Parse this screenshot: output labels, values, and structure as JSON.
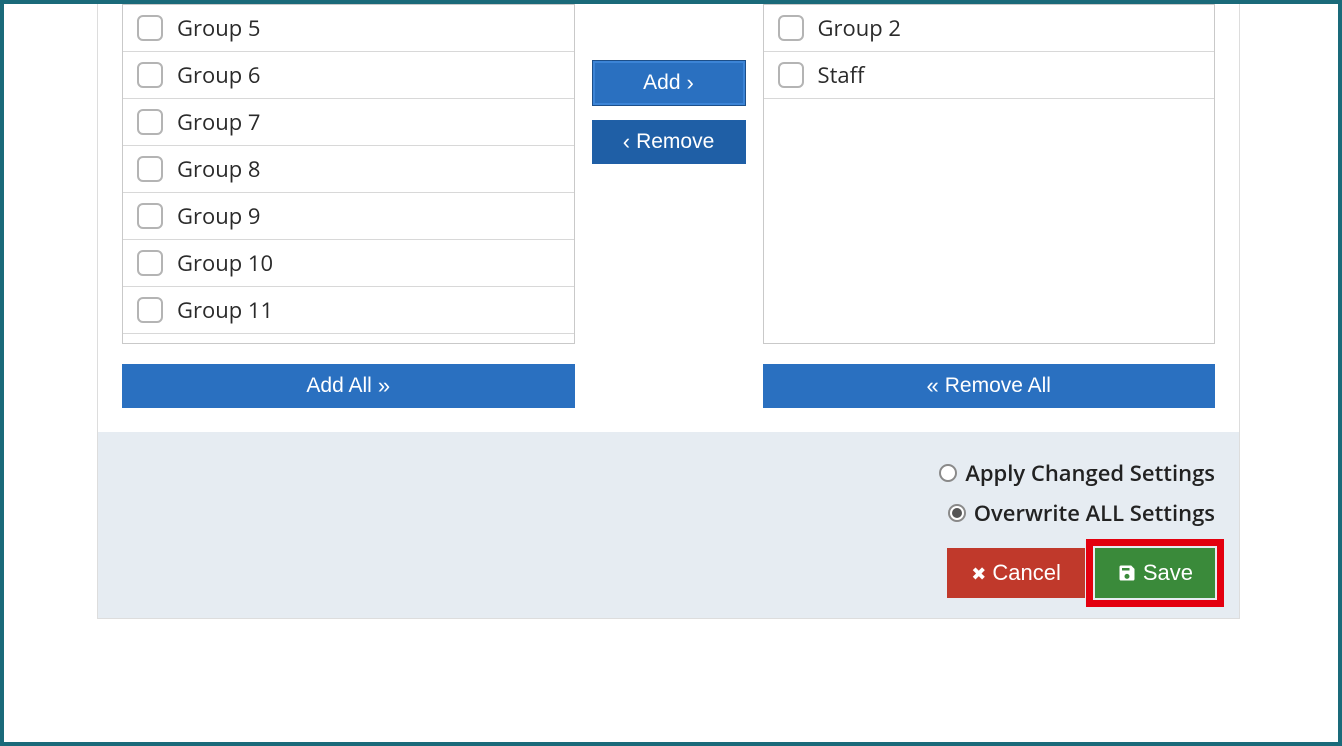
{
  "available_groups": [
    "Group 5",
    "Group 6",
    "Group 7",
    "Group 8",
    "Group 9",
    "Group 10",
    "Group 11"
  ],
  "selected_groups": [
    "Group 2",
    "Staff"
  ],
  "buttons": {
    "add": "Add",
    "remove": "Remove",
    "add_all": "Add All",
    "remove_all": "Remove All",
    "cancel": "Cancel",
    "save": "Save"
  },
  "settings": {
    "apply_label": "Apply Changed Settings",
    "overwrite_label": "Overwrite ALL Settings",
    "selected": "overwrite"
  },
  "colors": {
    "primary": "#2a70c0",
    "danger": "#c0392b",
    "success": "#3a8a3a",
    "highlight": "#e3000f",
    "frame": "#1a6a7a"
  }
}
